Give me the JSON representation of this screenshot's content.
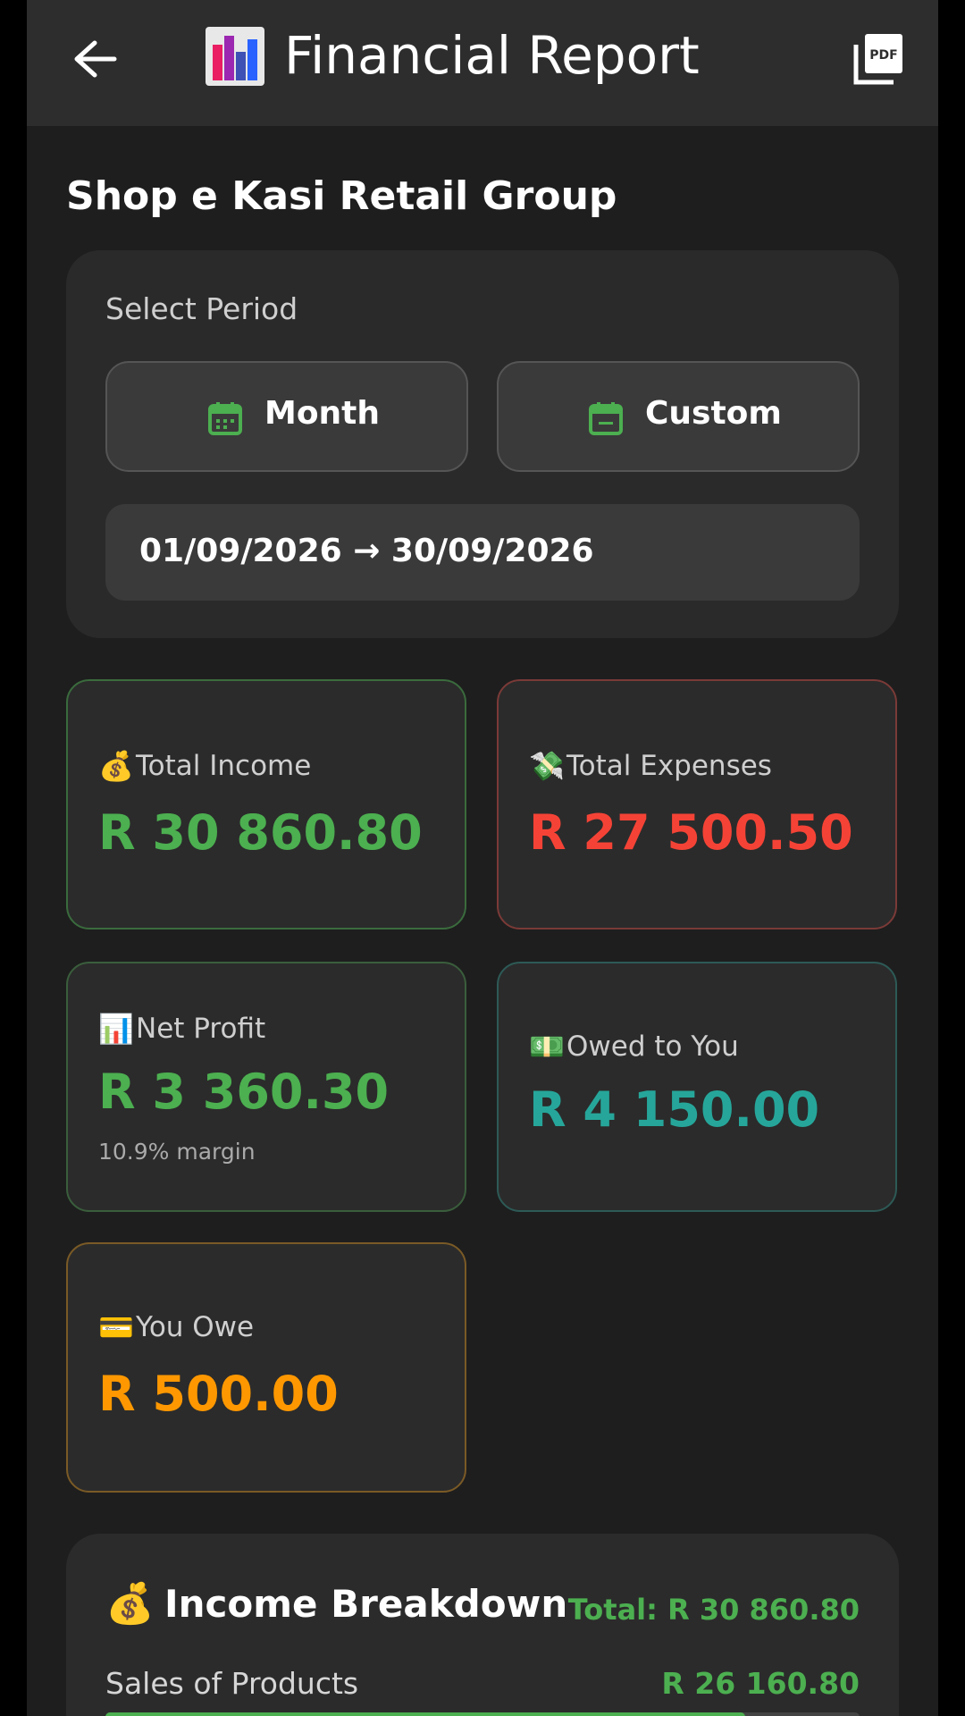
{
  "header": {
    "title": "Financial Report",
    "back_icon": "arrow-left-icon",
    "title_icon": "bar-chart-icon",
    "pdf_icon": "pdf-export-icon",
    "pdf_text": "PDF"
  },
  "shop": {
    "name": "Shop e Kasi Retail Group"
  },
  "period": {
    "label": "Select Period",
    "month_label": "Month",
    "custom_label": "Custom",
    "range": "01/09/2026 → 30/09/2026",
    "icon": "calendar-icon",
    "icon_color": "#4caf50"
  },
  "stats": {
    "income": {
      "label": "Total Income",
      "emoji": "💰",
      "value": "R 30 860.80",
      "color": "#4caf50",
      "border": "#3a6b3d"
    },
    "expenses": {
      "label": "Total Expenses",
      "emoji": "💸",
      "value": "R 27 500.50",
      "color": "#f44336",
      "border": "#7a3a37"
    },
    "profit": {
      "label": "Net Profit",
      "emoji": "📊",
      "value": "R 3 360.30",
      "sub": "10.9% margin",
      "color": "#4caf50",
      "border": "#3a5e3c"
    },
    "owed": {
      "label": "Owed to You",
      "emoji": "💵",
      "value": "R 4 150.00",
      "color": "#26a69a",
      "border": "#2d5a56"
    },
    "you_owe": {
      "label": "You Owe",
      "emoji": "💳",
      "value": "R 500.00",
      "color": "#ff9800",
      "border": "#7a5a26"
    }
  },
  "income_breakdown": {
    "emoji": "💰",
    "title": "Income Breakdown",
    "total": "Total: R 30 860.80",
    "rows": [
      {
        "label": "Sales of Products",
        "value": "R 26 160.80",
        "share": 0.848
      }
    ]
  }
}
